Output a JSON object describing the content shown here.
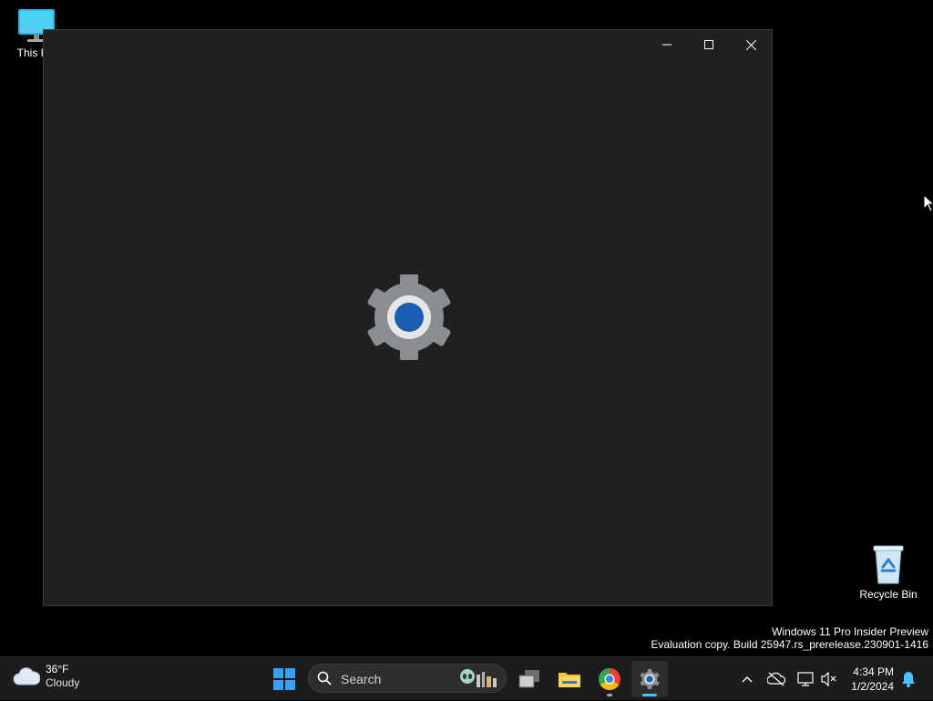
{
  "desktop": {
    "icons": [
      {
        "label": "This PC"
      },
      {
        "label": "Recycle Bin"
      }
    ],
    "watermark": {
      "line1": "Windows 11 Pro Insider Preview",
      "line2": "Evaluation copy. Build 25947.rs_prerelease.230901-1416"
    }
  },
  "window": {
    "app": "Settings",
    "splash_icon": "gear-icon",
    "controls": [
      "minimize-icon",
      "maximize-icon",
      "close-icon"
    ]
  },
  "taskbar": {
    "weather": {
      "temp": "36°F",
      "condition": "Cloudy",
      "icon": "cloud-icon"
    },
    "search": {
      "placeholder": "Search"
    },
    "apps": [
      {
        "name": "start",
        "icon": "windows-logo-icon"
      },
      {
        "name": "task-view",
        "icon": "task-view-icon"
      },
      {
        "name": "file-explorer",
        "icon": "folder-icon"
      },
      {
        "name": "chrome",
        "icon": "chrome-icon"
      },
      {
        "name": "settings",
        "icon": "gear-icon",
        "active": true
      }
    ],
    "tray": {
      "icons": [
        "chevron-up-icon",
        "onedrive-offline-icon",
        "network-icon",
        "volume-muted-icon",
        "bell-icon"
      ],
      "time": "4:34 PM",
      "date": "1/2/2024"
    }
  },
  "colors": {
    "window_bg": "#202020",
    "taskbar_bg": "#1c1c1c",
    "accent": "#4cc2ff",
    "gear_center": "#1a5fb4"
  }
}
